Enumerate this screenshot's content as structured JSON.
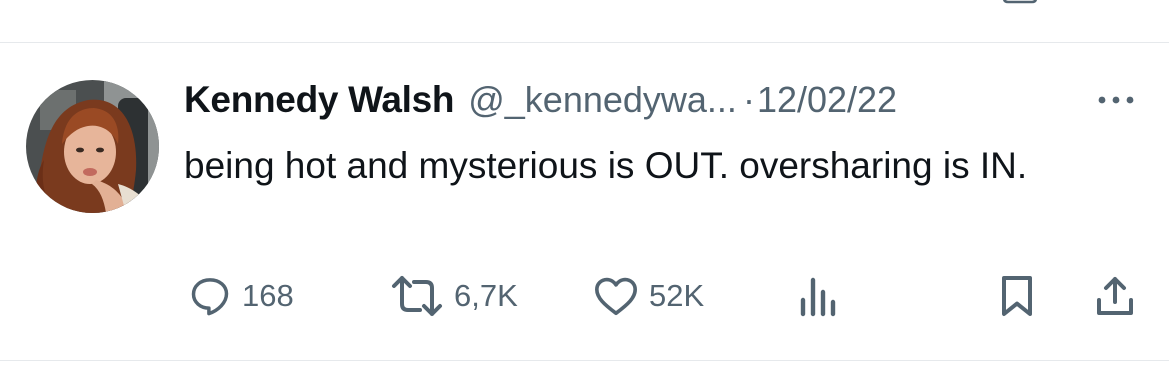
{
  "tweet": {
    "author": {
      "display_name": "Kennedy Walsh",
      "handle": "@_kennedywa..."
    },
    "separator": "·",
    "timestamp": "12/02/22",
    "text": "being hot and mysterious is OUT. oversharing is IN.",
    "actions": {
      "replies": "168",
      "reposts": "6,7K",
      "likes": "52K"
    }
  },
  "icons": {
    "reply": "reply-bubble-icon",
    "repost": "repost-icon",
    "like": "heart-icon",
    "views": "analytics-bars-icon",
    "bookmark": "bookmark-icon",
    "share": "share-upload-icon",
    "more": "more-dots-icon"
  },
  "colors": {
    "text_primary": "#0f1419",
    "text_secondary": "#536471",
    "divider": "#e6e9ec"
  }
}
